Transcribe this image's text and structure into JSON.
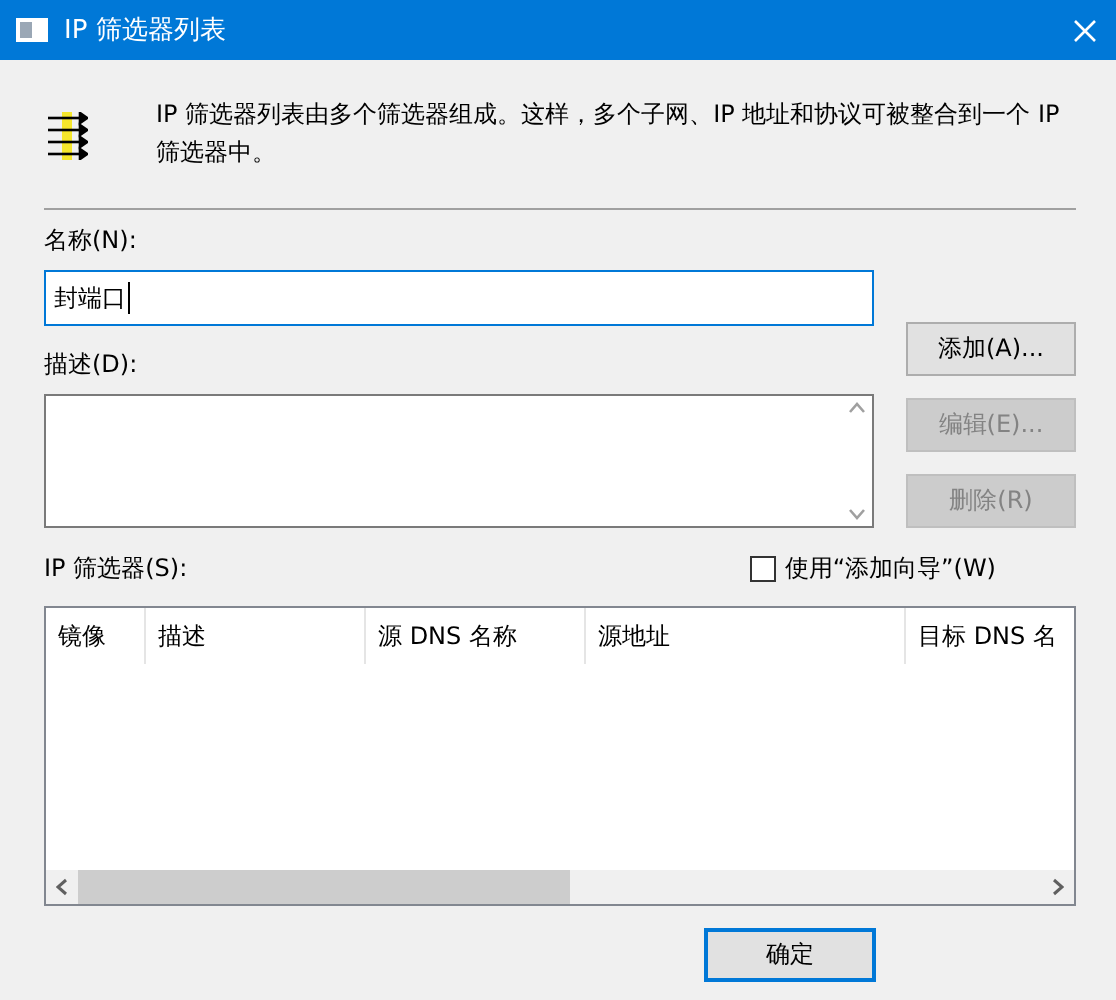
{
  "window": {
    "title": "IP 筛选器列表"
  },
  "intro": "IP 筛选器列表由多个筛选器组成。这样，多个子网、IP 地址和协议可被整合到一个 IP 筛选器中。",
  "name": {
    "label": "名称(N):",
    "value": "封端口",
    "focused": true
  },
  "description": {
    "label": "描述(D):"
  },
  "side_buttons": [
    {
      "label": "添加(A)...",
      "disabled": false
    },
    {
      "label": "编辑(E)...",
      "disabled": true
    },
    {
      "label": "删除(R)",
      "disabled": true
    }
  ],
  "filters": {
    "label": "IP 筛选器(S):",
    "wizard": {
      "label": "使用“添加向导”(W)",
      "checked": false
    },
    "columns": [
      "镜像",
      "描述",
      "源 DNS 名称",
      "源地址",
      "目标 DNS 名"
    ]
  },
  "footer_buttons": [
    {
      "label": "确定",
      "default": true
    }
  ]
}
